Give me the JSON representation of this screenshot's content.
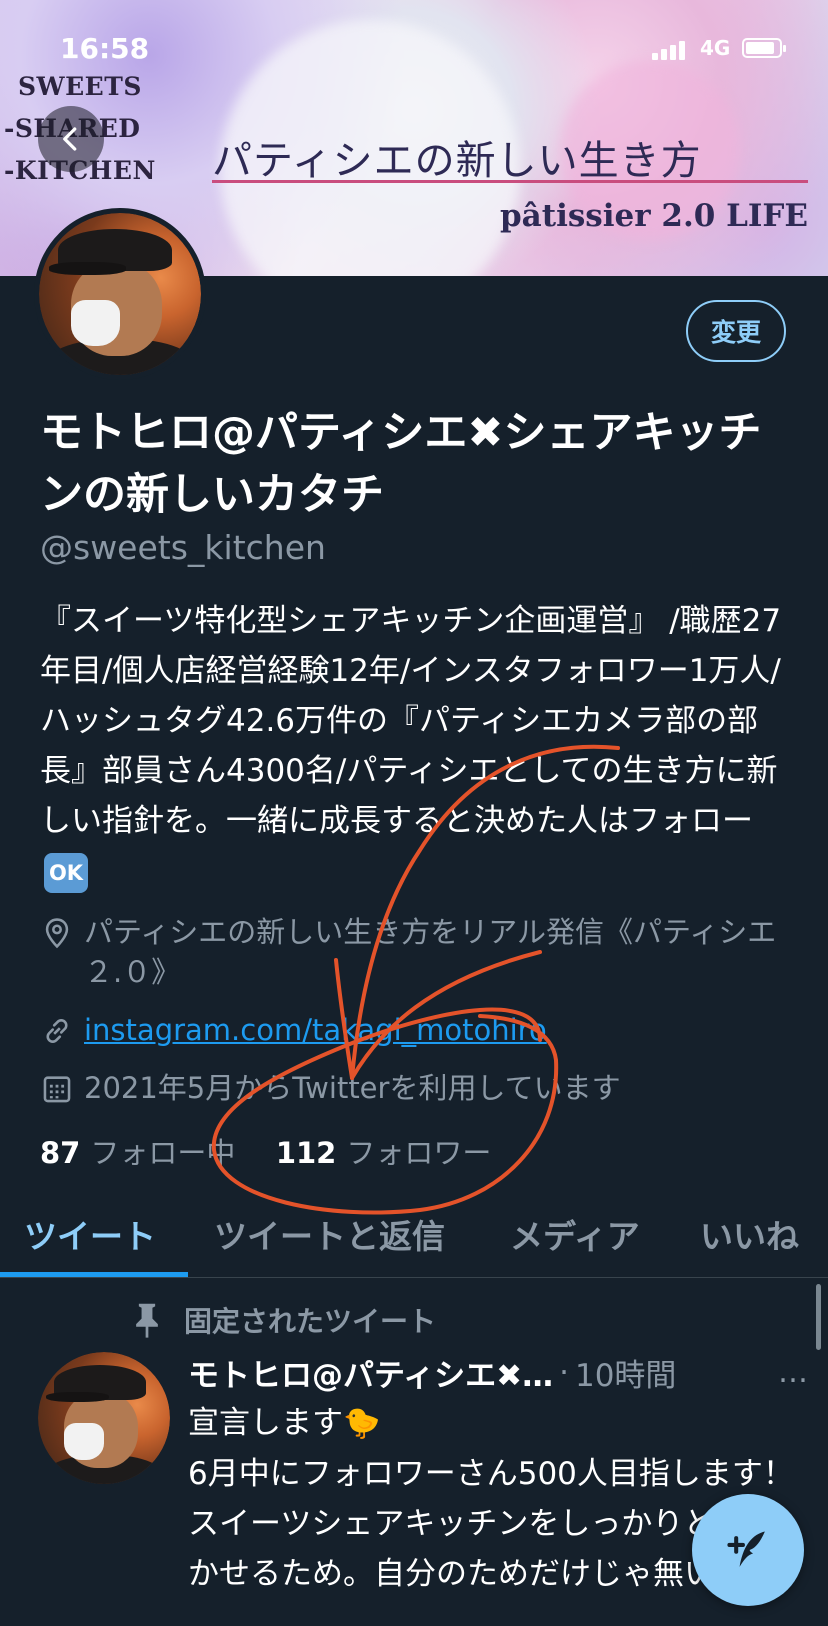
{
  "status_bar": {
    "time": "16:58",
    "network": "4G"
  },
  "banner": {
    "logo_lines": [
      "SWEETS",
      "-SHARED",
      "-KITCHEN"
    ],
    "title": "パティシエの新しい生き方",
    "subtitle": "pâtissier 2.0 LIFE"
  },
  "profile": {
    "edit_button": "変更",
    "display_name": "モトヒロ@パティシエ✖︎シェアキッチンの新しいカタチ",
    "handle": "@sweets_kitchen",
    "bio": "『スイーツ特化型シェアキッチン企画運営』 /職歴27年目/個人店経営経験12年/インスタフォロワー1万人/ハッシュタグ42.6万件の『パティシエカメラ部の部長』部員さん4300名/パティシエとしての生き方に新しい指針を。一緒に成長すると決めた人はフォロー",
    "bio_emoji": "OK",
    "location": "パティシエの新しい生き方をリアル発信《パティシエ２.０》",
    "link": "instagram.com/takagi_motohiro",
    "joined": "2021年5月からTwitterを利用しています",
    "following_count": "87",
    "following_label": "フォロー中",
    "followers_count": "112",
    "followers_label": "フォロワー"
  },
  "tabs": [
    {
      "label": "ツイート",
      "active": true
    },
    {
      "label": "ツイートと返信",
      "active": false
    },
    {
      "label": "メディア",
      "active": false
    },
    {
      "label": "いいね",
      "active": false
    }
  ],
  "pinned_tweet": {
    "pinned_label": "固定されたツイート",
    "author": "モトヒロ@パティシエ✖︎…",
    "time": "10時間",
    "more": "…",
    "line1": "宣言します",
    "emoji": "🐤",
    "text": "6月中にフォロワーさん500人目指します！スイーツシェアキッチンをしっかりと根付かせるため。自分のためだけじゃ無い。"
  },
  "colors": {
    "background": "#15202b",
    "accent": "#1d9bf0",
    "accent_light": "#8ecdf8",
    "secondary_text": "#8b98a5",
    "annotation": "#e4532a"
  },
  "icons": [
    "chevron-left-icon",
    "location-pin-icon",
    "link-icon",
    "calendar-icon",
    "pin-icon",
    "compose-tweet-icon"
  ]
}
